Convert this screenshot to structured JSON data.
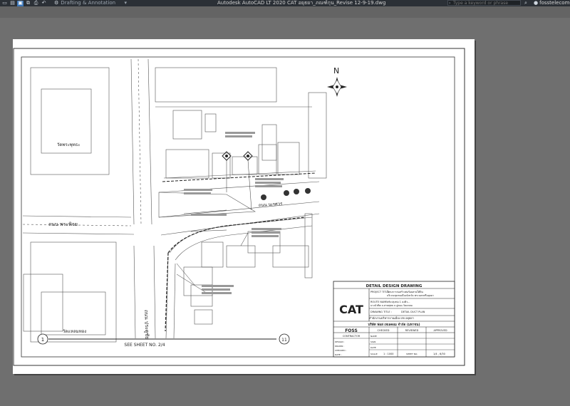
{
  "titlebar": {
    "workspace": "Drafting & Annotation",
    "app_title": "Autodesk AutoCAD LT 2020    CAT อยุธยา_ภณฑ์กุน_Revise 12-9-19.dwg",
    "search_placeholder": "Type a keyword or phrase",
    "user": "fosstelecom-..."
  },
  "drawing": {
    "north": "N",
    "road_left": "ถนน พระพิจย",
    "road_bottom": "ถนน ประตูชัย",
    "road_center": "ถนน นเรศวร",
    "building_top_left": "วัดพระพุทธะ",
    "building_bottom_left": "วัดแหลมทอง",
    "see_sheet": "SEE SHEET NO. 2/4",
    "circle_left": "1",
    "circle_right": "11"
  },
  "titleblock": {
    "header": "DETAIL DESIGN DRAWING",
    "company_logo": "CAT",
    "project_title_label": "PROJECT TITLE :",
    "project_title_line1": "โครงการก่อสร้างท่อร้อยสายใต้ดิน",
    "project_title_line2": "บริเวณชุมชนเมืองจังหวัด พระนครศรีอยุธยา",
    "route_name_label": "ROUTE NAME :",
    "route_name_line1": "ปรับปรุงท่อ 1 ลงคิว...",
    "route_name_line2": "บางบัวทิต ถ.สายพุทธ ถ.อู่ทอง-วัดแหลม",
    "drawing_title_label": "DRAWING TITLE :",
    "drawing_title": "DETAIL DUCT PLAN",
    "client_line": "สำนักงานบริหารงานเมือง สย อยุธยา",
    "contractor_company": "บริษัท ฟอส เทเลคอม จำกัด (มหาชน)",
    "foss": "FOSS",
    "col_contractor": "CONTRACTOR",
    "col_checked": "CHECKED",
    "col_reviewed": "REVIEWED",
    "col_approved": "APPROVED",
    "rows": [
      "DESIGN :",
      "DRAWN :",
      "CHECKED :",
      "DATE :"
    ],
    "name": "NAME",
    "sign": "SIGN",
    "date": "DATE",
    "scale_label": "SCALE",
    "scale_value": "1 : 1000",
    "sheet_label": "SHEET NO.",
    "sheet_value": "1/4 , 6/30"
  }
}
